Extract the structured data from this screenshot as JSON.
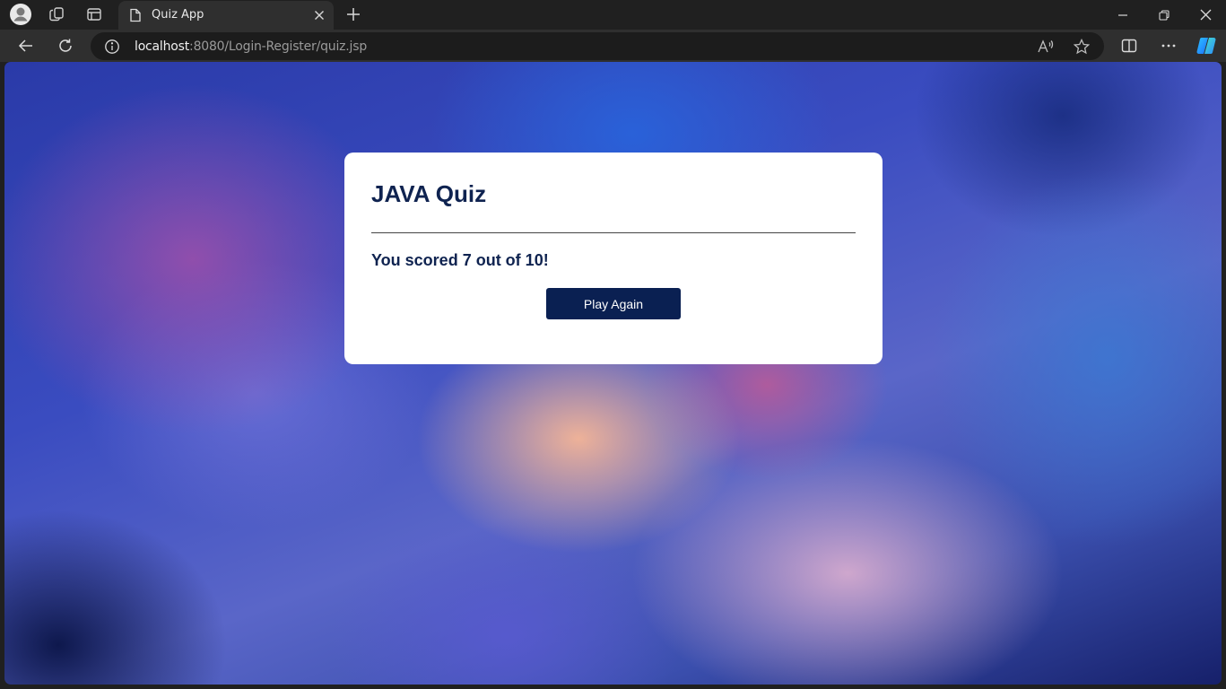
{
  "browser": {
    "tab": {
      "title": "Quiz App"
    },
    "address": {
      "host": "localhost",
      "rest": ":8080/Login-Register/quiz.jsp"
    }
  },
  "page": {
    "quiz_title": "JAVA Quiz",
    "score_text": "You scored 7 out of 10!",
    "play_again_label": "Play Again"
  }
}
